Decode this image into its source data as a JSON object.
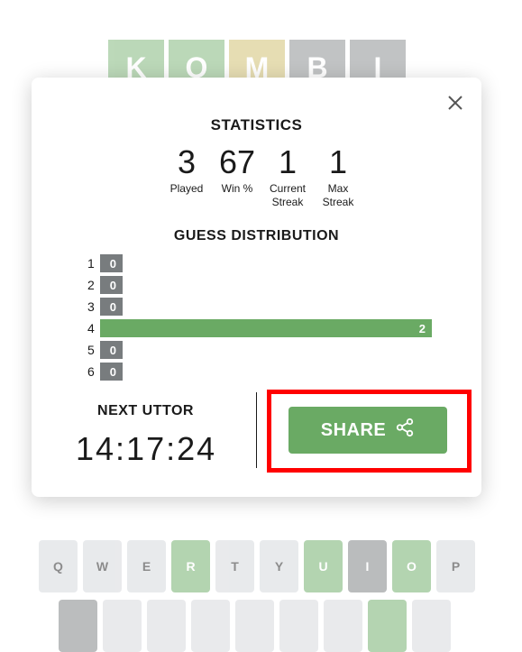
{
  "board": {
    "tiles": [
      {
        "letter": "K",
        "state": "correct"
      },
      {
        "letter": "O",
        "state": "correct"
      },
      {
        "letter": "M",
        "state": "present"
      },
      {
        "letter": "B",
        "state": "absent"
      },
      {
        "letter": "I",
        "state": "absent"
      }
    ]
  },
  "modal": {
    "title": "STATISTICS",
    "stats": [
      {
        "value": "3",
        "label": "Played"
      },
      {
        "value": "67",
        "label": "Win %"
      },
      {
        "value": "1",
        "label": "Current Streak"
      },
      {
        "value": "1",
        "label": "Max Streak"
      }
    ],
    "distribution_title": "GUESS DISTRIBUTION",
    "distribution": [
      {
        "guess": "1",
        "count": 0,
        "highlight": false
      },
      {
        "guess": "2",
        "count": 0,
        "highlight": false
      },
      {
        "guess": "3",
        "count": 0,
        "highlight": false
      },
      {
        "guess": "4",
        "count": 2,
        "highlight": true
      },
      {
        "guess": "5",
        "count": 0,
        "highlight": false
      },
      {
        "guess": "6",
        "count": 0,
        "highlight": false
      }
    ],
    "next_label": "NEXT UTTOR",
    "timer": "14:17:24",
    "share_label": "SHARE",
    "close_icon": "close-icon",
    "share_icon": "share-icon"
  },
  "keyboard": {
    "row1": [
      {
        "key": "Q",
        "state": "plain"
      },
      {
        "key": "W",
        "state": "plain"
      },
      {
        "key": "E",
        "state": "plain"
      },
      {
        "key": "R",
        "state": "correct"
      },
      {
        "key": "T",
        "state": "plain"
      },
      {
        "key": "Y",
        "state": "plain"
      },
      {
        "key": "U",
        "state": "correct"
      },
      {
        "key": "I",
        "state": "absent"
      },
      {
        "key": "O",
        "state": "correct"
      },
      {
        "key": "P",
        "state": "plain"
      }
    ],
    "row2": [
      {
        "key": "",
        "state": "absent"
      },
      {
        "key": "",
        "state": "plain"
      },
      {
        "key": "",
        "state": "plain"
      },
      {
        "key": "",
        "state": "plain"
      },
      {
        "key": "",
        "state": "plain"
      },
      {
        "key": "",
        "state": "plain"
      },
      {
        "key": "",
        "state": "plain"
      },
      {
        "key": "",
        "state": "correct"
      },
      {
        "key": "",
        "state": "plain"
      }
    ]
  },
  "colors": {
    "correct": "#6aaa64",
    "present": "#c9b458",
    "absent": "#787c7e",
    "highlight_border": "#ff0000"
  }
}
